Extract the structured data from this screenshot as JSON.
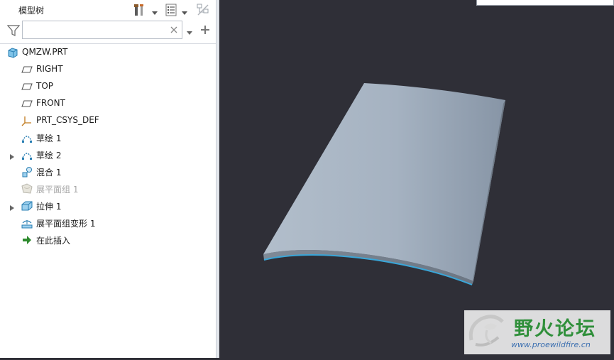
{
  "model_tree": {
    "title": "模型树",
    "search": {
      "value": "",
      "placeholder": ""
    },
    "items": [
      {
        "label": "QMZW.PRT",
        "icon": "part-icon",
        "level": 0,
        "expandable": false,
        "disabled": false
      },
      {
        "label": "RIGHT",
        "icon": "datum-plane-icon",
        "level": 1,
        "expandable": false,
        "disabled": false
      },
      {
        "label": "TOP",
        "icon": "datum-plane-icon",
        "level": 1,
        "expandable": false,
        "disabled": false
      },
      {
        "label": "FRONT",
        "icon": "datum-plane-icon",
        "level": 1,
        "expandable": false,
        "disabled": false
      },
      {
        "label": "PRT_CSYS_DEF",
        "icon": "coordinate-system-icon",
        "level": 1,
        "expandable": false,
        "disabled": false
      },
      {
        "label": "草绘 1",
        "icon": "sketch-icon",
        "level": 1,
        "expandable": false,
        "disabled": false
      },
      {
        "label": "草绘 2",
        "icon": "sketch-icon",
        "level": 1,
        "expandable": true,
        "disabled": false
      },
      {
        "label": "混合 1",
        "icon": "blend-icon",
        "level": 1,
        "expandable": false,
        "disabled": false
      },
      {
        "label": "展平面组 1",
        "icon": "flatten-quilt-icon",
        "level": 1,
        "expandable": false,
        "disabled": true
      },
      {
        "label": "拉伸 1",
        "icon": "extrude-icon",
        "level": 1,
        "expandable": true,
        "disabled": false
      },
      {
        "label": "展平面组变形 1",
        "icon": "flatten-deform-icon",
        "level": 1,
        "expandable": false,
        "disabled": false
      },
      {
        "label": "在此插入",
        "icon": "insert-here-arrow-icon",
        "level": 1,
        "expandable": false,
        "disabled": false
      }
    ]
  },
  "watermark": {
    "title": "野火论坛",
    "url": "www.proewildfire.cn"
  },
  "colors": {
    "viewport_bg": "#2f2f37",
    "surface_light": "#a9b6c5",
    "surface_dark": "#8e9aa9",
    "edge_highlight": "#3aa6d8",
    "insert_arrow": "#2e8b2e"
  }
}
